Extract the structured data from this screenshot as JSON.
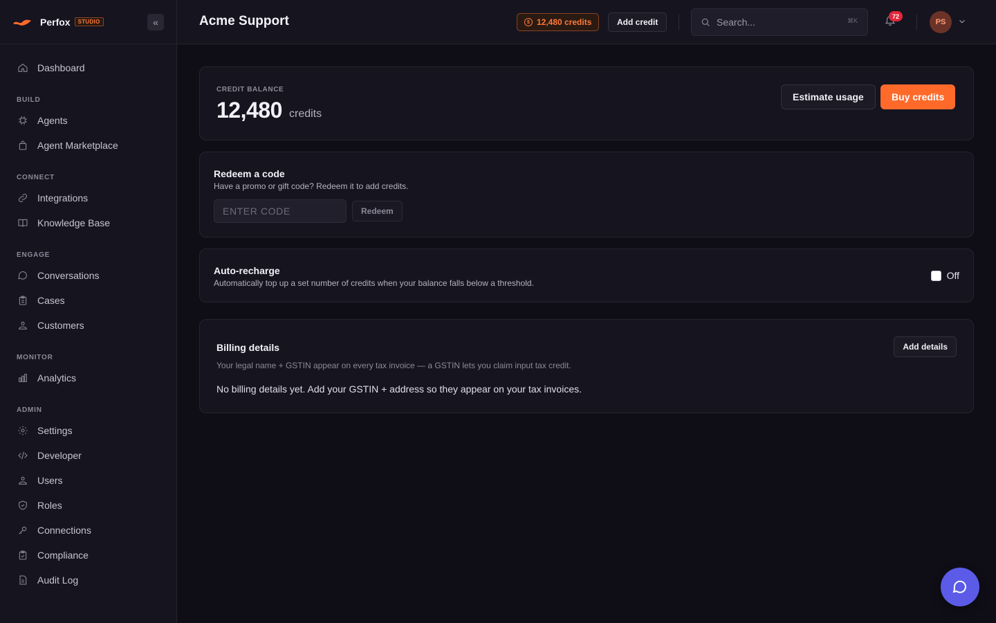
{
  "brand": {
    "name": "Perfox",
    "tag": "STUDIO"
  },
  "sidebar": {
    "items": [
      {
        "label": "Dashboard",
        "icon": "home-icon"
      }
    ],
    "sections": [
      {
        "title": "BUILD",
        "items": [
          {
            "label": "Agents",
            "icon": "chip-icon"
          },
          {
            "label": "Agent Marketplace",
            "icon": "bag-icon"
          }
        ]
      },
      {
        "title": "CONNECT",
        "items": [
          {
            "label": "Integrations",
            "icon": "link-icon"
          },
          {
            "label": "Knowledge Base",
            "icon": "book-icon"
          }
        ]
      },
      {
        "title": "ENGAGE",
        "items": [
          {
            "label": "Conversations",
            "icon": "chat-icon"
          },
          {
            "label": "Cases",
            "icon": "clipboard-icon"
          },
          {
            "label": "Customers",
            "icon": "users-icon"
          }
        ]
      },
      {
        "title": "MONITOR",
        "items": [
          {
            "label": "Analytics",
            "icon": "bar-chart-icon"
          }
        ]
      },
      {
        "title": "ADMIN",
        "items": [
          {
            "label": "Settings",
            "icon": "gear-icon"
          },
          {
            "label": "Developer",
            "icon": "code-icon"
          },
          {
            "label": "Users",
            "icon": "user-icon"
          },
          {
            "label": "Roles",
            "icon": "shield-icon"
          },
          {
            "label": "Connections",
            "icon": "key-icon"
          },
          {
            "label": "Compliance",
            "icon": "clipboard-check-icon"
          },
          {
            "label": "Audit Log",
            "icon": "document-icon"
          }
        ]
      }
    ]
  },
  "header": {
    "title": "Acme Support",
    "credits_pill": "12,480 credits",
    "add_credit": "Add credit",
    "search_placeholder": "Search...",
    "search_shortcut": "⌘K",
    "notification_count": "72",
    "avatar_initials": "PS"
  },
  "balance": {
    "label": "CREDIT BALANCE",
    "value": "12,480",
    "unit": "credits",
    "estimate_btn": "Estimate usage",
    "buy_btn": "Buy credits"
  },
  "redeem": {
    "title": "Redeem a code",
    "subtitle": "Have a promo or gift code? Redeem it to add credits.",
    "placeholder": "ENTER CODE",
    "button": "Redeem"
  },
  "recharge": {
    "title": "Auto-recharge",
    "subtitle": "Automatically top up a set number of credits when your balance falls below a threshold.",
    "state": "Off"
  },
  "billing": {
    "title": "Billing details",
    "subtitle": "Your legal name + GSTIN appear on every tax invoice — a GSTIN lets you claim input tax credit.",
    "button": "Add details",
    "empty": "No billing details yet. Add your GSTIN + address so they appear on your tax invoices."
  },
  "colors": {
    "accent": "#ff6a2a",
    "chat_fab": "#5b5be8",
    "badge": "#e3263a"
  }
}
